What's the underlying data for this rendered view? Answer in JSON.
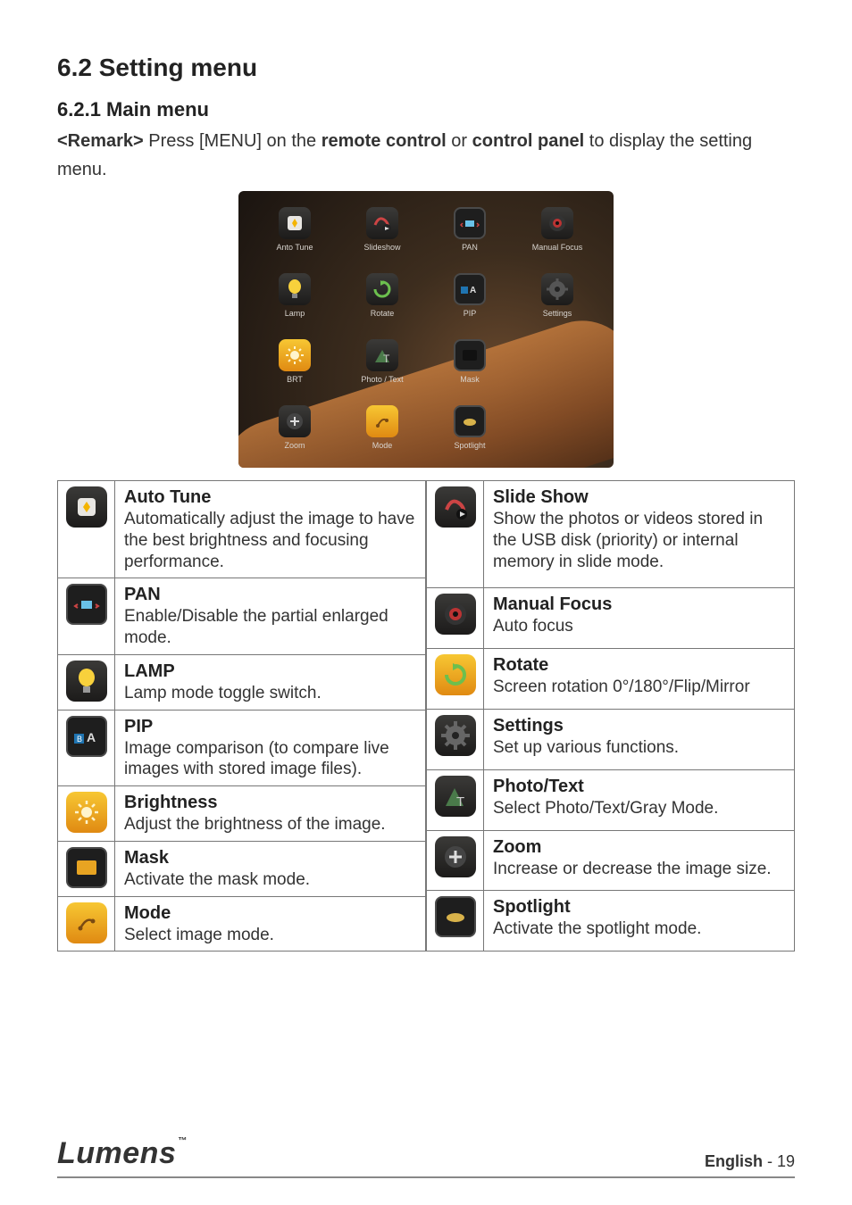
{
  "headings": {
    "h2": "6.2 Setting menu",
    "h3": "6.2.1 Main menu"
  },
  "intro": {
    "remark_label": "<Remark>",
    "t1": " Press [MENU] on the ",
    "b1": "remote control",
    "t2": " or ",
    "b2": "control panel",
    "t3": " to display the setting menu."
  },
  "hero": [
    {
      "label": "Anto Tune"
    },
    {
      "label": "Slideshow"
    },
    {
      "label": "PAN"
    },
    {
      "label": "Manual Focus"
    },
    {
      "label": "Lamp"
    },
    {
      "label": "Rotate"
    },
    {
      "label": "PIP"
    },
    {
      "label": "Settings"
    },
    {
      "label": "BRT"
    },
    {
      "label": "Photo / Text"
    },
    {
      "label": "Mask"
    },
    {
      "label": ""
    },
    {
      "label": "Zoom"
    },
    {
      "label": "Mode"
    },
    {
      "label": "Spotlight"
    },
    {
      "label": ""
    }
  ],
  "left": [
    {
      "title": "Auto Tune",
      "desc": "Automatically adjust the image to have the best brightness and focusing performance."
    },
    {
      "title": "PAN",
      "desc": "Enable/Disable the partial enlarged mode."
    },
    {
      "title": "LAMP",
      "desc": "Lamp mode toggle switch."
    },
    {
      "title": "PIP",
      "desc": "Image comparison (to compare live images with stored image files)."
    },
    {
      "title": "Brightness",
      "desc": "Adjust the brightness of the image."
    },
    {
      "title": "Mask",
      "desc": "Activate the mask mode."
    },
    {
      "title": "Mode",
      "desc": "Select image mode."
    }
  ],
  "right": [
    {
      "title": "Slide Show",
      "desc": "Show the photos or videos stored in the USB disk (priority) or internal memory in slide mode."
    },
    {
      "title": "Manual Focus",
      "desc": "Auto focus"
    },
    {
      "title": "Rotate",
      "desc": "Screen rotation 0°/180°/Flip/Mirror"
    },
    {
      "title": "Settings",
      "desc": "Set up various functions."
    },
    {
      "title": "Photo/Text",
      "desc": "Select Photo/Text/Gray Mode."
    },
    {
      "title": "Zoom",
      "desc": "Increase or decrease the image size."
    },
    {
      "title": "Spotlight",
      "desc": "Activate the spotlight mode."
    }
  ],
  "footer": {
    "logo": "Lumens",
    "tm": "™",
    "lang": "English",
    "dash": "  -  ",
    "page": "19"
  }
}
